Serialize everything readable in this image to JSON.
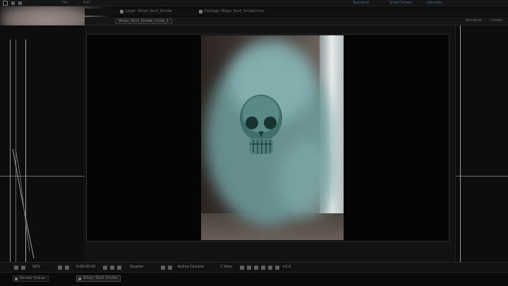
{
  "menubar": {
    "items": [
      "File",
      "Edit"
    ],
    "workspaces": [
      "Standard",
      "Small Screen",
      "Libraries"
    ]
  },
  "tabs": [
    {
      "label": "Layer: Wisps_Skull_Smoke"
    },
    {
      "label": "Footage: Wisps_Skull_Smoke.mov"
    }
  ],
  "comp": {
    "tab_label": "Wisps_Skull_Smoke_Comp_1",
    "right_panels": [
      "Renderer:",
      "Classic"
    ]
  },
  "footer": {
    "zoom": "50%",
    "timecode": "0:00:00:00",
    "resolution": "Quarter",
    "camera": "Active Camera",
    "view": "1 View",
    "exposure": "+0.0"
  },
  "bottom_tabs": [
    {
      "label": "Render Queue"
    },
    {
      "label": "Wisps_Skull_Smoke"
    }
  ],
  "colors": {
    "background": "#0c0c0c",
    "smoke": "#6e9e9f",
    "accent_blue": "#4d6b8a"
  }
}
